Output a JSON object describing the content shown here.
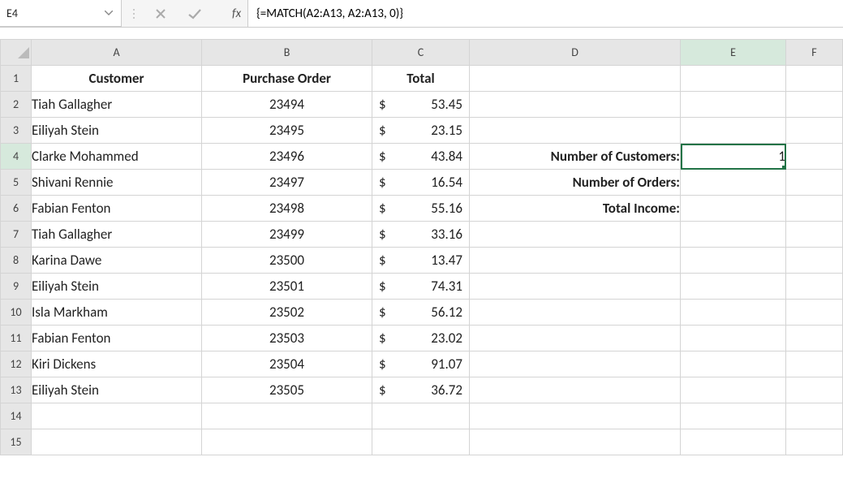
{
  "nameBox": "E4",
  "formula": "{=MATCH(A2:A13, A2:A13, 0)}",
  "fx": "fx",
  "colHeaders": [
    "A",
    "B",
    "C",
    "D",
    "E",
    "F"
  ],
  "rowHeaders": [
    "1",
    "2",
    "3",
    "4",
    "5",
    "6",
    "7",
    "8",
    "9",
    "10",
    "11",
    "12",
    "13",
    "14",
    "15"
  ],
  "headerRow": {
    "A": "Customer",
    "B": "Purchase Order",
    "C": "Total"
  },
  "data": [
    {
      "customer": "Tiah Gallagher",
      "order": "23494",
      "total": "53.45"
    },
    {
      "customer": "Eiliyah Stein",
      "order": "23495",
      "total": "23.15"
    },
    {
      "customer": "Clarke Mohammed",
      "order": "23496",
      "total": "43.84"
    },
    {
      "customer": "Shivani Rennie",
      "order": "23497",
      "total": "16.54"
    },
    {
      "customer": "Fabian Fenton",
      "order": "23498",
      "total": "55.16"
    },
    {
      "customer": "Tiah Gallagher",
      "order": "23499",
      "total": "33.16"
    },
    {
      "customer": "Karina Dawe",
      "order": "23500",
      "total": "13.47"
    },
    {
      "customer": "Eiliyah Stein",
      "order": "23501",
      "total": "74.31"
    },
    {
      "customer": "Isla Markham",
      "order": "23502",
      "total": "56.12"
    },
    {
      "customer": "Fabian Fenton",
      "order": "23503",
      "total": "23.02"
    },
    {
      "customer": "Kiri Dickens",
      "order": "23504",
      "total": "91.07"
    },
    {
      "customer": "Eiliyah Stein",
      "order": "23505",
      "total": "36.72"
    }
  ],
  "labels": {
    "numCustomers": "Number of Customers:",
    "numOrders": "Number of Orders:",
    "totalIncome": "Total Income:"
  },
  "values": {
    "numCustomers": "1"
  },
  "currencySymbol": "$"
}
